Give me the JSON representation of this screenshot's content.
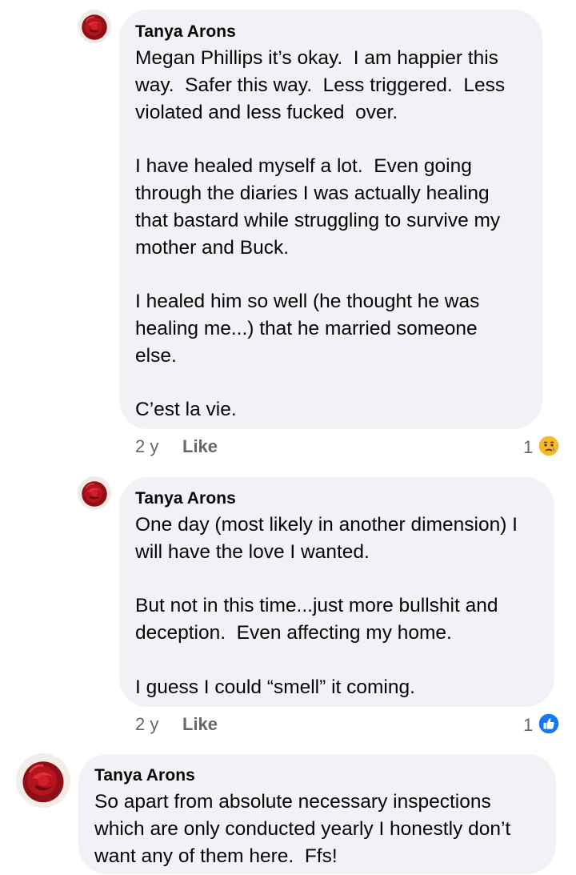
{
  "comments": [
    {
      "author": "Tanya Arons",
      "lines": [
        "Megan Phillips it’s okay.  I am happier this",
        "way.  Safer this way.  Less triggered.  Less",
        "violated and less fucked  over.",
        "",
        "I have healed myself a lot.  Even going",
        "through the diaries I was actually healing",
        "that bastard while struggling to survive my",
        "mother and Buck.",
        "",
        "I healed him so well (he thought he was",
        "healing me...) that he married someone",
        "else.",
        "",
        "C’est la vie."
      ],
      "time": "2 y",
      "like_label": "Like",
      "reaction_count": "1",
      "reaction_icon": "sad-reaction-icon"
    },
    {
      "author": "Tanya Arons",
      "lines": [
        "One day (most likely in another dimension) I",
        "will have the love I wanted.",
        "",
        "But not in this time...just more bullshit and",
        "deception.  Even affecting my home.",
        "",
        "I guess I could “smell” it coming."
      ],
      "time": "2 y",
      "like_label": "Like",
      "reaction_count": "1",
      "reaction_icon": "like-reaction-icon"
    },
    {
      "author": "Tanya Arons",
      "lines": [
        "So apart from absolute necessary inspections",
        "which are only conducted yearly I honestly don’t",
        "want any of them here.  Ffs!"
      ]
    }
  ],
  "colors": {
    "bubble": "#f0f2f5",
    "meta_text": "#65676b",
    "like_blue": "#1877f2",
    "sad_yellow": "#f7b928",
    "rose_red": "#b3141e"
  }
}
